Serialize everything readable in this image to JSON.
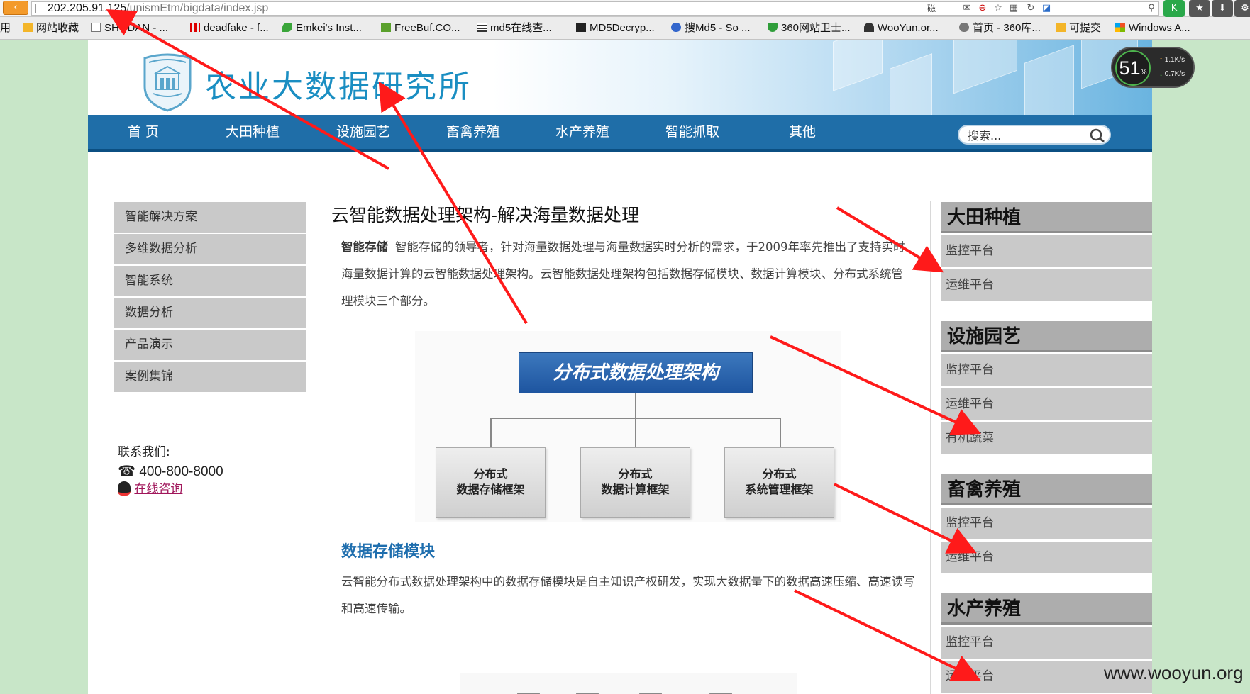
{
  "browser": {
    "url_host": "202.205.91.125",
    "url_path": "/unismEtm/bigdata/index.jsp",
    "back_glyph": "‹",
    "right_icons": [
      "磁",
      "search-icon"
    ],
    "bookmarks": [
      {
        "label": "用",
        "icon": "none"
      },
      {
        "label": "网站收藏",
        "icon": "folder-icon"
      },
      {
        "label": "SHODAN - ...",
        "icon": "page-icon"
      },
      {
        "label": "deadfake - f...",
        "icon": "red-bars-icon"
      },
      {
        "label": "Emkei's Inst...",
        "icon": "green-leaf-icon"
      },
      {
        "label": "FreeBuf.CO...",
        "icon": "freebuf-icon"
      },
      {
        "label": "md5在线查...",
        "icon": "grid-icon"
      },
      {
        "label": "MD5Decryp...",
        "icon": "dark-square-icon"
      },
      {
        "label": "搜Md5 - So ...",
        "icon": "sou-icon"
      },
      {
        "label": "360网站卫士...",
        "icon": "shield-icon"
      },
      {
        "label": "WooYun.or...",
        "icon": "wooyun-icon"
      },
      {
        "label": "首页 - 360库...",
        "icon": "gear-icon"
      },
      {
        "label": "可提交",
        "icon": "folder-icon"
      },
      {
        "label": "Windows A...",
        "icon": "windows-icon"
      }
    ]
  },
  "site": {
    "title": "农业大数据研究所",
    "nav": [
      "首  页",
      "大田种植",
      "设施园艺",
      "畜禽养殖",
      "水产养殖",
      "智能抓取",
      "其他"
    ],
    "search_placeholder": "搜索..."
  },
  "left_menu": [
    "智能解决方案",
    "多维数据分析",
    "智能系统",
    "数据分析",
    "产品演示",
    "案例集锦"
  ],
  "contact": {
    "label": "联系我们:",
    "phone": "400-800-8000",
    "consult": "在线咨询"
  },
  "main": {
    "title": "云智能数据处理架构-解决海量数据处理",
    "intro_lead": "智能存储",
    "intro_text": "智能存储的领导者，针对海量数据处理与海量数据实时分析的需求，于2009年率先推出了支持实时海量数据计算的云智能数据处理架构。云智能数据处理架构包括数据存储模块、数据计算模块、分布式系统管理模块三个部分。",
    "diagram_top": "分布式数据处理架构",
    "diagram_boxes": [
      {
        "line1": "分布式",
        "line2": "数据存储框架"
      },
      {
        "line1": "分布式",
        "line2": "数据计算框架"
      },
      {
        "line1": "分布式",
        "line2": "系统管理框架"
      }
    ],
    "module_title": "数据存储模块",
    "module_text": "云智能分布式数据处理架构中的数据存储模块是自主知识产权研发，实现大数据量下的数据高速压缩、高速读写和高速传输。"
  },
  "right_menu": [
    {
      "title": "大田种植",
      "items": [
        "监控平台",
        "运维平台"
      ]
    },
    {
      "title": "设施园艺",
      "items": [
        "监控平台",
        "运维平台",
        "有机蔬菜"
      ]
    },
    {
      "title": "畜禽养殖",
      "items": [
        "监控平台",
        "运维平台"
      ]
    },
    {
      "title": "水产养殖",
      "items": [
        "监控平台",
        "运维平台"
      ]
    }
  ],
  "overlay": {
    "speed_percent": "51",
    "speed_unit": "%",
    "upload": "1.1K/s",
    "download": "0.7K/s",
    "watermark": "www.wooyun.org",
    "annotation_color": "#ff1a1a"
  }
}
